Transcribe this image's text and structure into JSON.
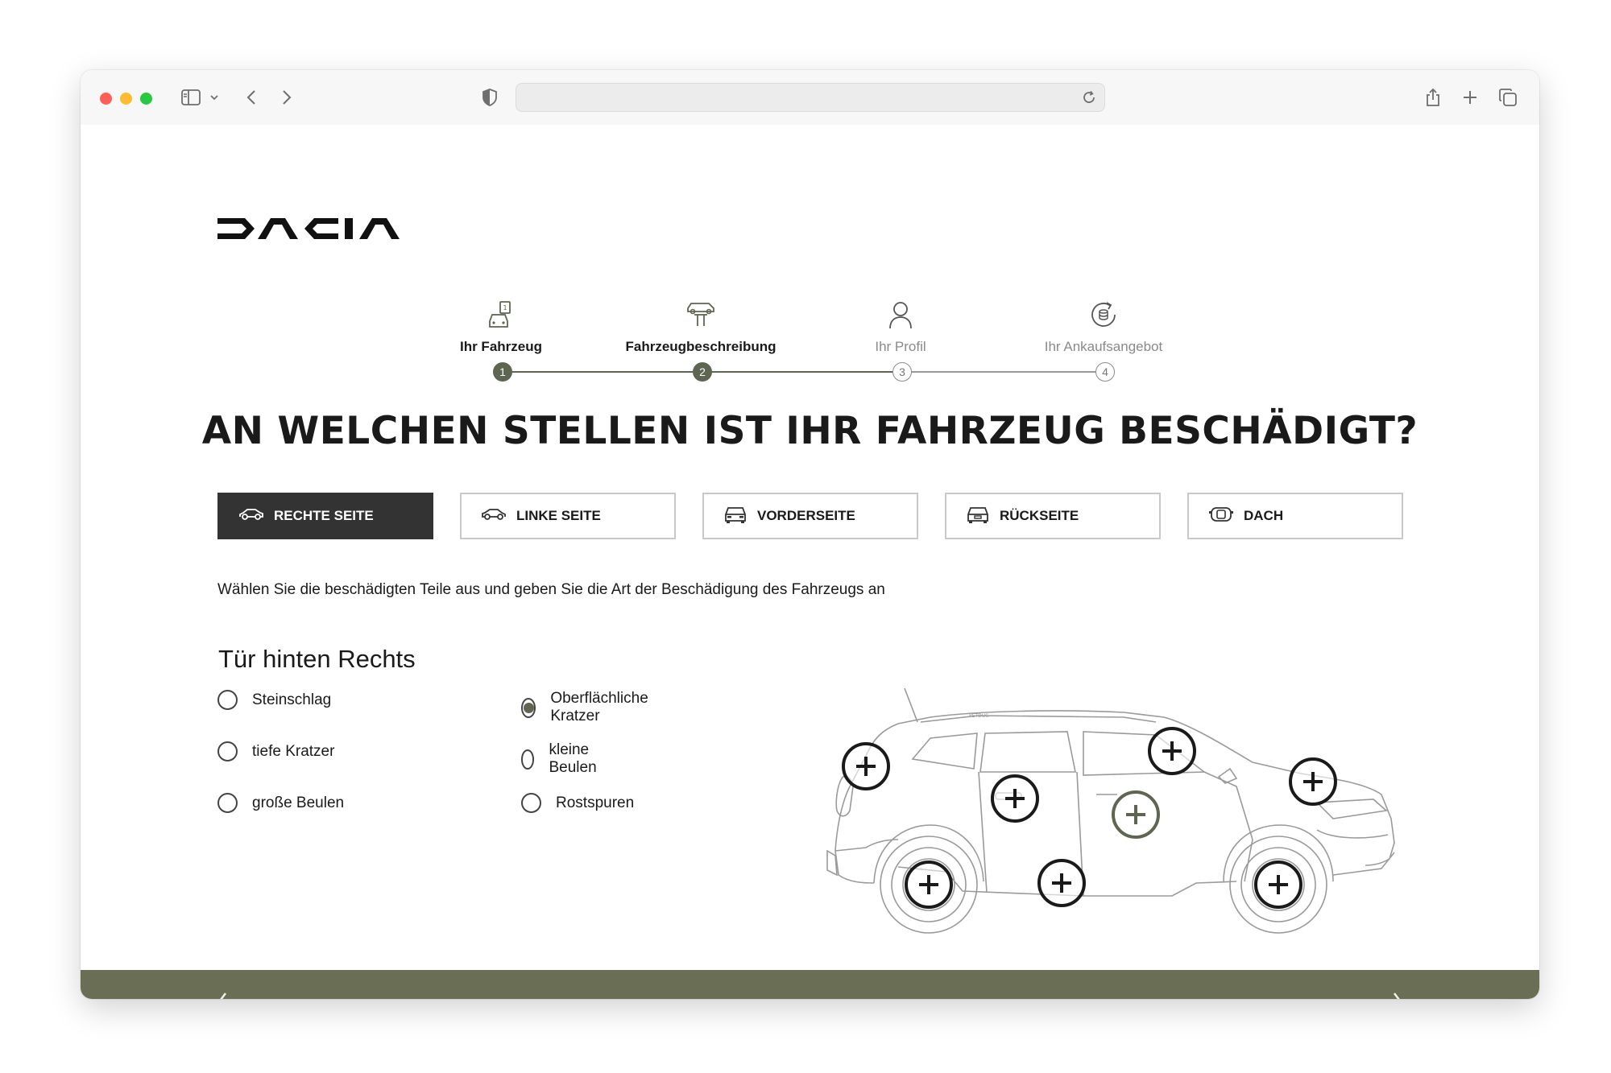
{
  "browser": {
    "icons": [
      "sidebar-icon",
      "chevron-down-icon",
      "back-icon",
      "forward-icon",
      "shield-icon",
      "reload-icon",
      "share-icon",
      "new-tab-icon",
      "tabs-icon"
    ]
  },
  "brand": {
    "logo_text": "DACIA"
  },
  "stepper": {
    "steps": [
      {
        "number": "1",
        "label": "Ihr Fahrzeug",
        "state": "done",
        "icon": "car-document-icon"
      },
      {
        "number": "2",
        "label": "Fahrzeugbeschreibung",
        "state": "done",
        "icon": "car-lift-icon"
      },
      {
        "number": "3",
        "label": "Ihr Profil",
        "state": "todo",
        "icon": "person-icon"
      },
      {
        "number": "4",
        "label": "Ihr Ankaufsangebot",
        "state": "todo",
        "icon": "coin-refresh-icon"
      }
    ]
  },
  "page": {
    "title": "AN WELCHEN STELLEN IST IHR FAHRZEUG BESCHÄDIGT?",
    "instruction": "Wählen Sie die beschädigten Teile aus und geben Sie die Art der Beschädigung des Fahrzeugs an",
    "part_title": "Tür hinten Rechts"
  },
  "tabs": [
    {
      "label": "RECHTE SEITE",
      "active": true,
      "icon": "car-side-right-icon"
    },
    {
      "label": "LINKE SEITE",
      "active": false,
      "icon": "car-side-left-icon"
    },
    {
      "label": "VORDERSEITE",
      "active": false,
      "icon": "car-front-icon"
    },
    {
      "label": "RÜCKSEITE",
      "active": false,
      "icon": "car-rear-icon"
    },
    {
      "label": "DACH",
      "active": false,
      "icon": "car-roof-icon"
    }
  ],
  "damage_options": [
    {
      "label": "Steinschlag",
      "checked": false
    },
    {
      "label": "Oberflächliche Kratzer",
      "checked": true
    },
    {
      "label": "tiefe Kratzer",
      "checked": false
    },
    {
      "label": "kleine Beulen",
      "checked": false
    },
    {
      "label": "große Beulen",
      "checked": false
    },
    {
      "label": "Rostspuren",
      "checked": false
    }
  ],
  "car_diagram": {
    "hotspots": [
      {
        "name": "hotspot-rear-quarter",
        "selected": false
      },
      {
        "name": "hotspot-rear-door",
        "selected": false
      },
      {
        "name": "hotspot-front-door",
        "selected": true
      },
      {
        "name": "hotspot-windshield",
        "selected": false
      },
      {
        "name": "hotspot-front-fender",
        "selected": false
      },
      {
        "name": "hotspot-rear-wheel",
        "selected": false
      },
      {
        "name": "hotspot-sill",
        "selected": false
      },
      {
        "name": "hotspot-front-wheel",
        "selected": false
      }
    ]
  },
  "colors": {
    "accent": "#5e6651",
    "footer": "#6a6e55",
    "active_tab": "#333333"
  }
}
